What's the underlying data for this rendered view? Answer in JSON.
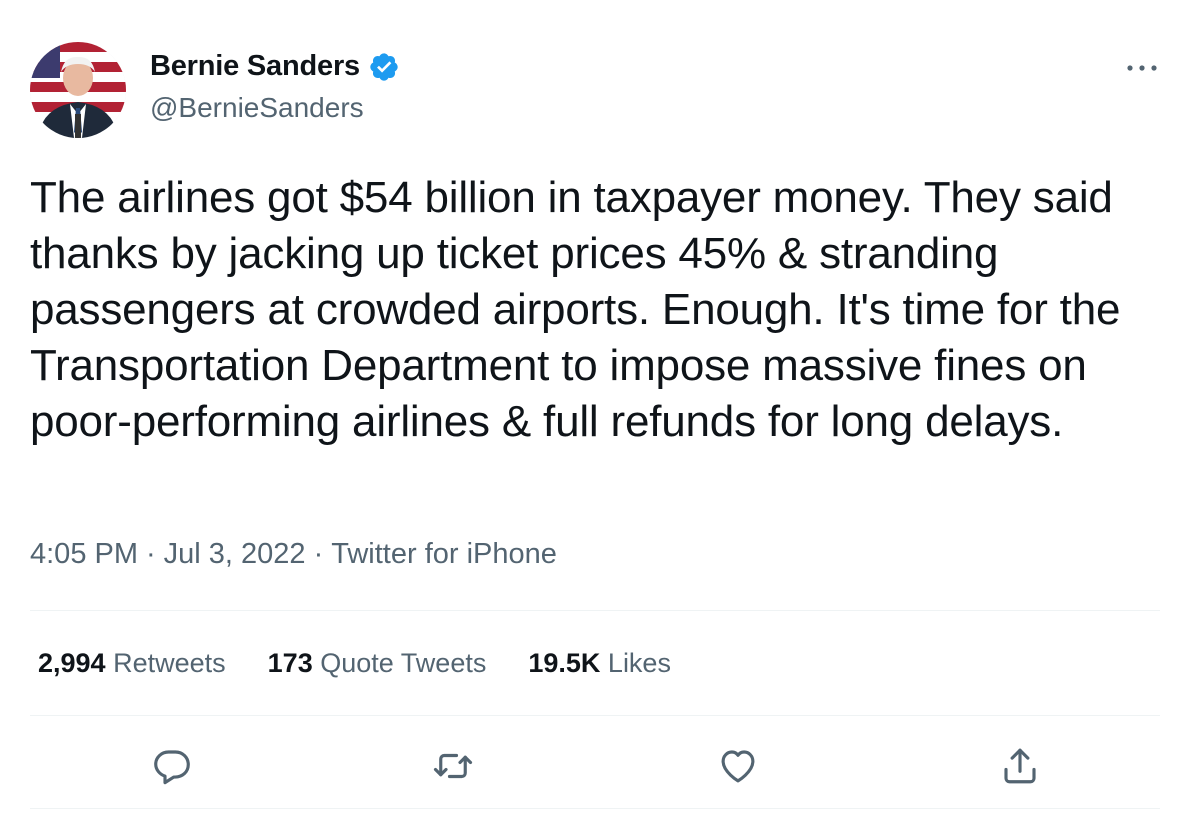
{
  "author": {
    "display_name": "Bernie Sanders",
    "handle": "@BernieSanders",
    "verified": true
  },
  "tweet": {
    "text": "The airlines got $54 billion in taxpayer money. They said thanks by jacking up ticket prices 45% & stranding passengers at crowded airports. Enough. It's time for the Transportation Department to impose massive fines on poor-performing airlines & full refunds for long delays.",
    "time": "4:05 PM",
    "separator": "·",
    "date": "Jul 3, 2022",
    "source": "Twitter for iPhone"
  },
  "stats": {
    "retweets_count": "2,994",
    "retweets_label": "Retweets",
    "quote_count": "173",
    "quote_label": "Quote Tweets",
    "likes_count": "19.5K",
    "likes_label": "Likes"
  },
  "icons": {
    "verified": "verified-badge-icon",
    "more": "more-options-icon",
    "reply": "reply-icon",
    "retweet": "retweet-icon",
    "like": "heart-icon",
    "share": "share-icon"
  },
  "colors": {
    "verified_blue": "#1d9bf0",
    "secondary_text": "#536471",
    "primary_text": "#0f1419",
    "divider": "#eff3f4"
  }
}
